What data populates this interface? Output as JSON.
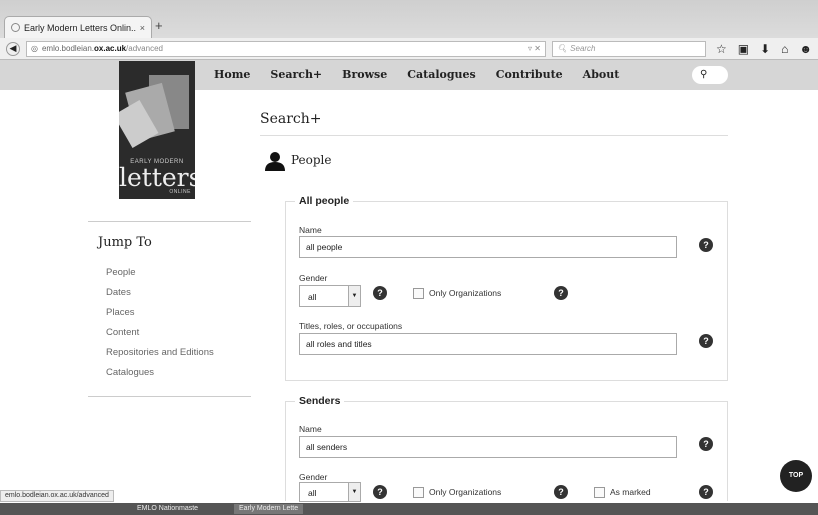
{
  "browser": {
    "tab_title": "Early Modern Letters Onlin...",
    "tab_close": "×",
    "new_tab": "+",
    "url_prefix": "emlo.bodleian.",
    "url_host": "ox.ac.uk",
    "url_path": "/advanced",
    "url_tools": "▿ ✕",
    "search_placeholder": "Search",
    "toolbar_icons": [
      "star-icon",
      "clipboard-icon",
      "download-icon",
      "home-icon",
      "chat-icon"
    ]
  },
  "site": {
    "logo": {
      "line1": "EARLY MODERN",
      "line2": "letters",
      "line3": "ONLINE"
    },
    "menu": [
      "Home",
      "Search+",
      "Browse",
      "Catalogues",
      "Contribute",
      "About"
    ],
    "search_icon": "⚲"
  },
  "sidebar": {
    "title": "Jump To",
    "items": [
      "People",
      "Dates",
      "Places",
      "Content",
      "Repositories and Editions",
      "Catalogues"
    ]
  },
  "main": {
    "heading": "Search+",
    "section_title": "People",
    "all_people": {
      "legend": "All people",
      "name_label": "Name",
      "name_value": "all people",
      "gender_label": "Gender",
      "gender_value": "all",
      "only_orgs_label": "Only Organizations",
      "titles_label": "Titles, roles, or occupations",
      "titles_value": "all roles and titles"
    },
    "senders": {
      "legend": "Senders",
      "name_label": "Name",
      "name_value": "all senders",
      "gender_label": "Gender",
      "gender_value": "all",
      "only_orgs_label": "Only Organizations",
      "as_marked_label": "As marked"
    },
    "help_glyph": "?",
    "select_arrow": "▼"
  },
  "top_button": "TOP",
  "status_url": "emlo.bodleian.ox.ac.uk/advanced",
  "taskbar": {
    "item1": "EMLO Nationmaste",
    "item2": "Early Modern Lette"
  }
}
